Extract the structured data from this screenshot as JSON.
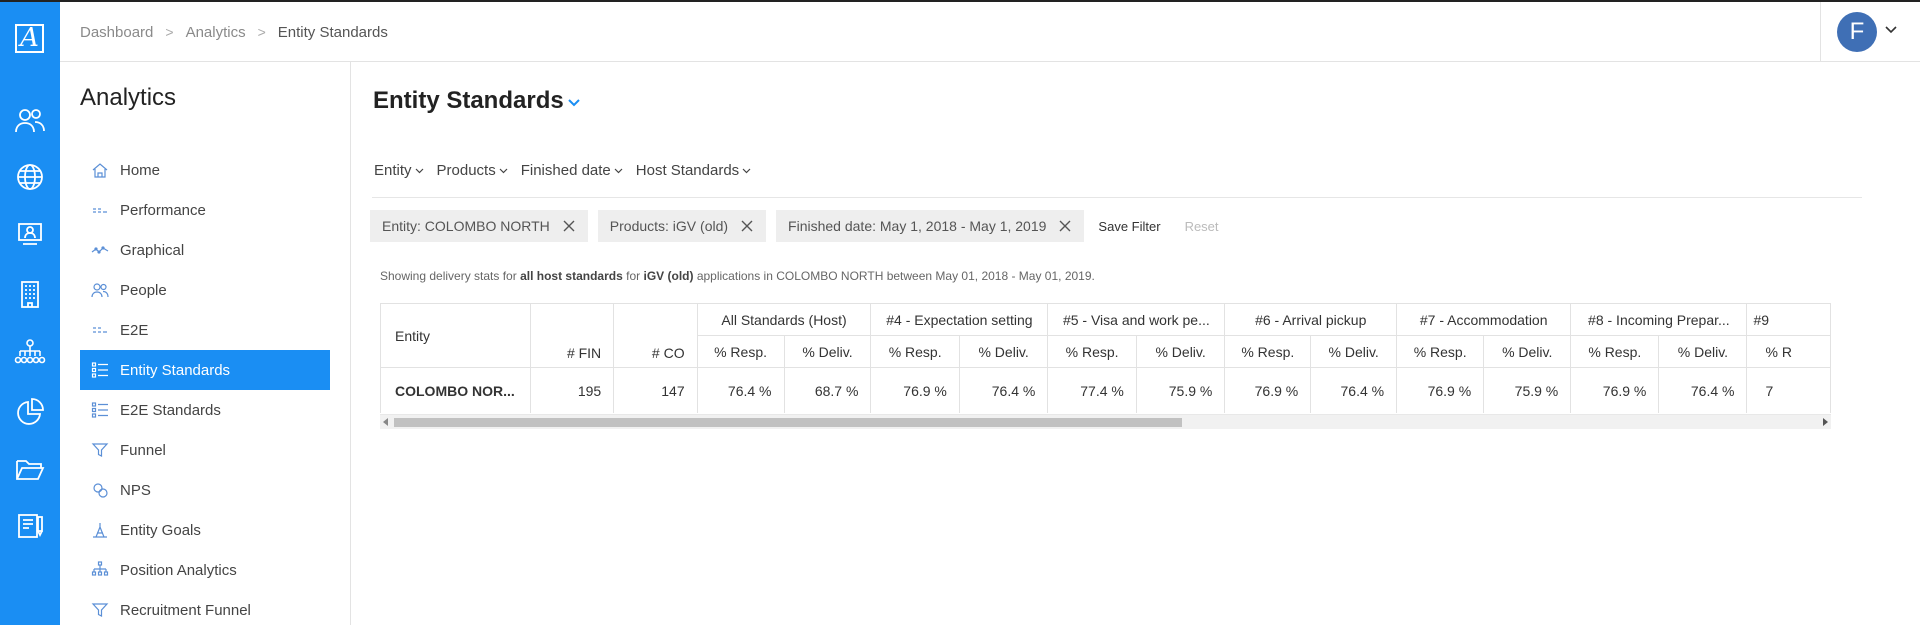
{
  "app": {
    "logo_letter": "A",
    "accent_color": "#1a8ef3"
  },
  "rail": {
    "icons": [
      "people-icon",
      "globe-icon",
      "presentation-icon",
      "building-icon",
      "org-chart-icon",
      "pie-chart-icon",
      "folder-open-icon",
      "report-icon"
    ]
  },
  "header": {
    "breadcrumbs": [
      "Dashboard",
      "Analytics",
      "Entity Standards"
    ],
    "user_initial": "F"
  },
  "sidebar": {
    "title": "Analytics",
    "items": [
      {
        "label": "Home",
        "icon": "home-icon",
        "active": false
      },
      {
        "label": "Performance",
        "icon": "performance-icon",
        "active": false
      },
      {
        "label": "Graphical",
        "icon": "line-chart-icon",
        "active": false
      },
      {
        "label": "People",
        "icon": "people-icon",
        "active": false
      },
      {
        "label": "E2E",
        "icon": "e2e-icon",
        "active": false
      },
      {
        "label": "Entity Standards",
        "icon": "checklist-icon",
        "active": true
      },
      {
        "label": "E2E Standards",
        "icon": "checklist-icon",
        "active": false
      },
      {
        "label": "Funnel",
        "icon": "funnel-icon",
        "active": false
      },
      {
        "label": "NPS",
        "icon": "nps-icon",
        "active": false
      },
      {
        "label": "Entity Goals",
        "icon": "goals-icon",
        "active": false
      },
      {
        "label": "Position Analytics",
        "icon": "hierarchy-icon",
        "active": false
      },
      {
        "label": "Recruitment Funnel",
        "icon": "funnel-icon",
        "active": false
      }
    ]
  },
  "main": {
    "title": "Entity Standards",
    "filters": [
      "Entity",
      "Products",
      "Finished date",
      "Host Standards"
    ],
    "chips": [
      "Entity: COLOMBO NORTH",
      "Products: iGV (old)",
      "Finished date: May 1, 2018 - May 1, 2019"
    ],
    "save_filter": "Save Filter",
    "reset": "Reset",
    "summary": {
      "p1": "Showing delivery stats for",
      "b1": "all host standards",
      "p2": "for",
      "b2": "iGV (old)",
      "p3": "applications in",
      "b3": "COLOMBO NORTH",
      "p4": "between",
      "b4": "May 01, 2018 - May 01, 2019."
    }
  },
  "table": {
    "entity_header": "Entity",
    "fin_header": "# FIN",
    "co_header": "# CO",
    "groups": [
      "All Standards (Host)",
      "#4 - Expectation setting",
      "#5 - Visa and work pe...",
      "#6 - Arrival pickup",
      "#7 - Accommodation",
      "#8 - Incoming Prepar...",
      "#9"
    ],
    "sub_resp": "% Resp.",
    "sub_deliv": "% Deliv.",
    "sub_partial": "% R",
    "row": {
      "entity": "COLOMBO NOR...",
      "fin": "195",
      "co": "147",
      "values": [
        "76.4 %",
        "68.7 %",
        "76.9 %",
        "76.4 %",
        "77.4 %",
        "75.9 %",
        "76.9 %",
        "76.4 %",
        "76.9 %",
        "75.9 %",
        "76.9 %",
        "76.4 %",
        "7"
      ]
    }
  }
}
